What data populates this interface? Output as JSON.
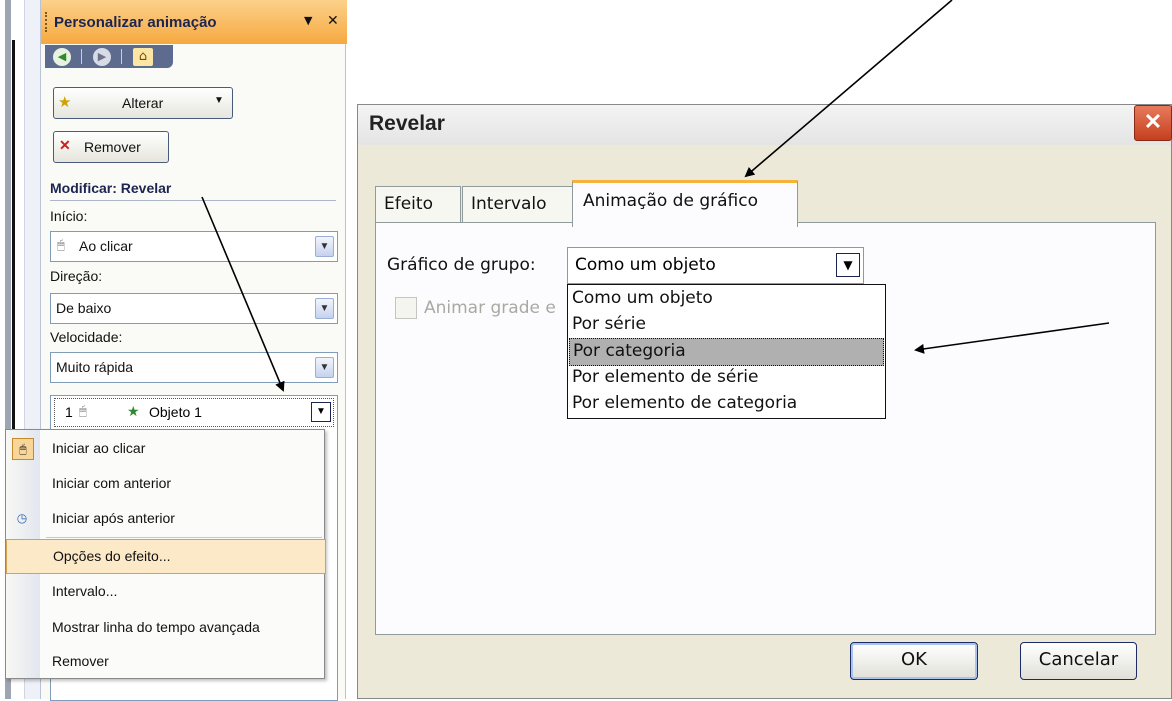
{
  "pane": {
    "title": "Personalizar animação",
    "change_label": "Alterar",
    "remove_label": "Remover",
    "modify_label": "Modificar: Revelar",
    "start_label": "Início:",
    "start_value": "Ao clicar",
    "direction_label": "Direção:",
    "direction_value": "De baixo",
    "speed_label": "Velocidade:",
    "speed_value": "Muito rápida",
    "item": {
      "number": "1",
      "name": "Objeto 1"
    }
  },
  "context_menu": [
    {
      "label": "Iniciar ao clicar"
    },
    {
      "label": "Iniciar com anterior"
    },
    {
      "label": "Iniciar após anterior"
    },
    {
      "label": "Opções do efeito..."
    },
    {
      "label": "Intervalo..."
    },
    {
      "label": "Mostrar linha do tempo avançada"
    },
    {
      "label": "Remover"
    }
  ],
  "dialog": {
    "title": "Revelar",
    "tabs": [
      "Efeito",
      "Intervalo",
      "Animação de gráfico"
    ],
    "group_label": "Gráfico de grupo:",
    "group_value": "Como um objeto",
    "animate_label": "Animar grade e",
    "options": [
      "Como um objeto",
      "Por série",
      "Por categoria",
      "Por elemento de série",
      "Por elemento de categoria"
    ],
    "selected_option": "Por categoria",
    "ok": "OK",
    "cancel": "Cancelar"
  },
  "colors": {
    "pane_header": "#f6a940",
    "highlight": "#fbe9c8",
    "tab_accent": "#f6b23a",
    "close_button": "#c4401e"
  }
}
